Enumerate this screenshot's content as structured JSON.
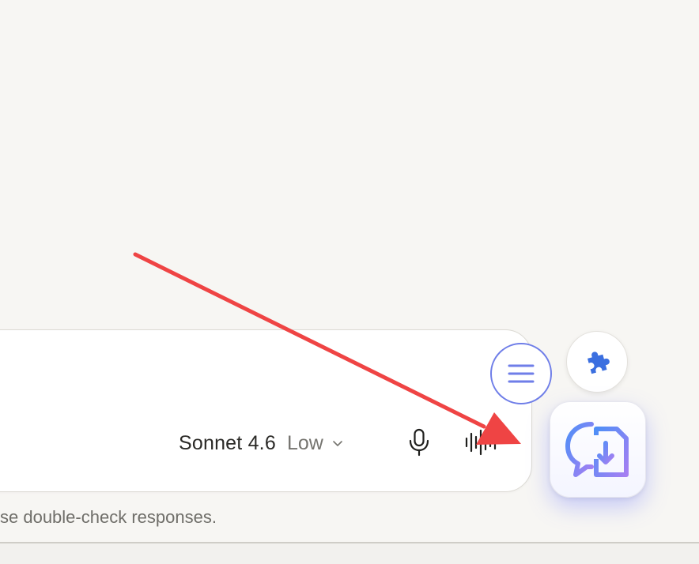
{
  "composer": {
    "model_name": "Sonnet 4.6",
    "effort_level": "Low",
    "icons": {
      "chevron": "chevron-down-icon",
      "mic": "microphone-icon",
      "voice": "voice-waveform-icon"
    }
  },
  "disclaimer": "se double-check responses.",
  "floating_buttons": {
    "menu": {
      "icon": "hamburger-menu-icon",
      "border_color": "#6f7ee8"
    },
    "extension": {
      "icon": "puzzle-piece-icon",
      "color": "#3b6fe0"
    },
    "app": {
      "icon": "chat-download-icon",
      "gradient": [
        "#4f8ff7",
        "#a57ff2"
      ]
    }
  },
  "annotation": {
    "type": "arrow",
    "color": "#ef4444"
  }
}
